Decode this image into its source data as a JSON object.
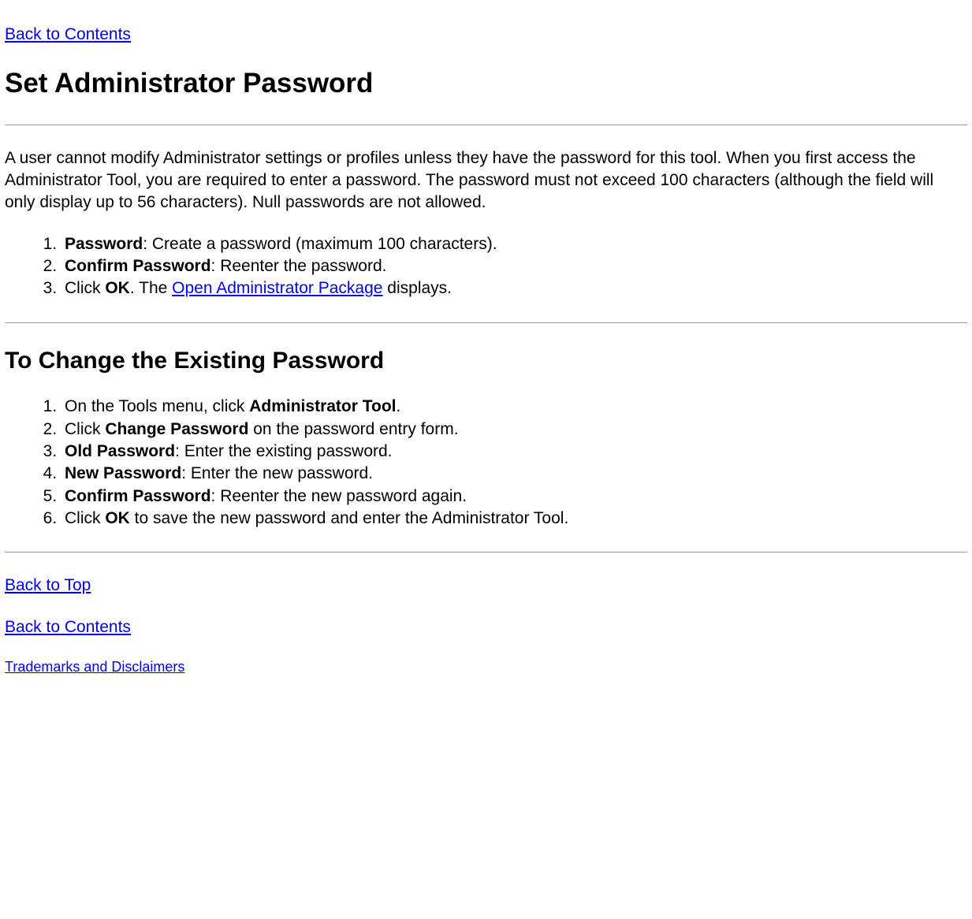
{
  "nav": {
    "back_to_contents": "Back to Contents",
    "back_to_top": "Back to Top",
    "trademarks": "Trademarks and Disclaimers"
  },
  "title_main": "Set Administrator Password",
  "intro_paragraph": "A user cannot modify Administrator settings or profiles unless they have the password for this tool. When you first access the Administrator Tool, you are required to enter a password. The password must not exceed 100 characters (although the field will only display up to 56 characters). Null passwords are not allowed.",
  "list1": {
    "item1_bold": "Password",
    "item1_rest": ": Create a password (maximum 100 characters).",
    "item2_bold": "Confirm Password",
    "item2_rest": ": Reenter the password.",
    "item3_pre": "Click ",
    "item3_bold": "OK",
    "item3_mid": ". The ",
    "item3_link": "Open Administrator Package",
    "item3_post": " displays."
  },
  "title_change": "To Change the Existing Password",
  "list2": {
    "item1_pre": "On the Tools menu, click ",
    "item1_bold": "Administrator Tool",
    "item1_post": ".",
    "item2_pre": "Click ",
    "item2_bold": "Change Password",
    "item2_post": " on the password entry form.",
    "item3_bold": "Old Password",
    "item3_rest": ": Enter the existing password.",
    "item4_bold": "New Password",
    "item4_rest": ": Enter the new password.",
    "item5_bold": "Confirm Password",
    "item5_rest": ": Reenter the new password again.",
    "item6_pre": "Click ",
    "item6_bold": "OK",
    "item6_post": " to save the new password and enter the Administrator Tool."
  }
}
